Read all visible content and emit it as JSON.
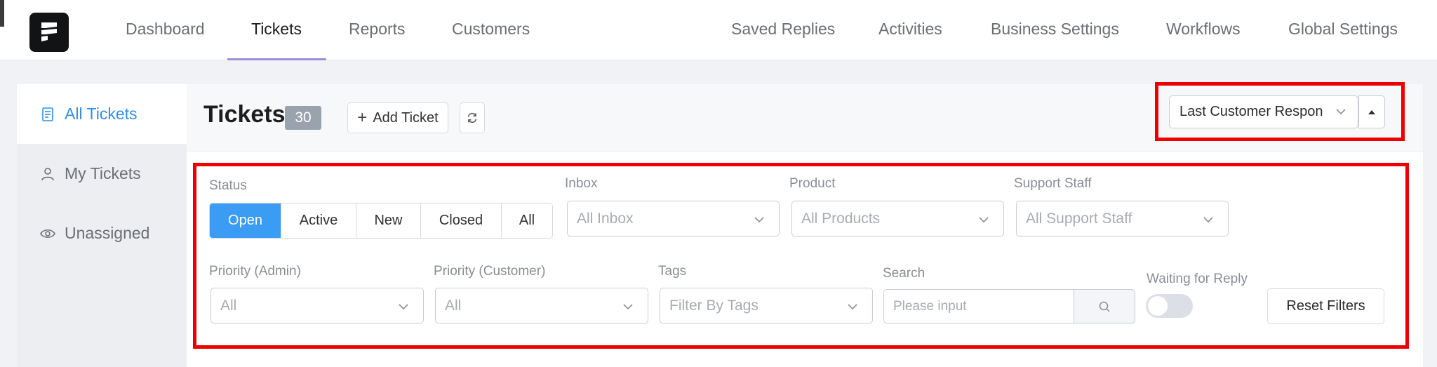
{
  "nav": {
    "left": [
      "Dashboard",
      "Tickets",
      "Reports",
      "Customers"
    ],
    "right": [
      "Saved Replies",
      "Activities",
      "Business Settings",
      "Workflows",
      "Global Settings"
    ],
    "active": "Tickets"
  },
  "sidebar": {
    "items": [
      {
        "label": "All Tickets",
        "icon": "document-icon",
        "active": true
      },
      {
        "label": "My Tickets",
        "icon": "user-icon",
        "active": false
      },
      {
        "label": "Unassigned",
        "icon": "eye-icon",
        "active": false
      }
    ]
  },
  "header": {
    "title": "Tickets",
    "count": "30",
    "add_ticket_label": "Add Ticket",
    "sort_value": "Last Customer Respon",
    "accent_color": "#3b9cf4",
    "highlight_color": "#ee0000"
  },
  "filters": {
    "status_label": "Status",
    "status_options": [
      "Open",
      "Active",
      "New",
      "Closed",
      "All"
    ],
    "status_selected": "Open",
    "inbox": {
      "label": "Inbox",
      "placeholder": "All Inbox"
    },
    "product": {
      "label": "Product",
      "placeholder": "All Products"
    },
    "support_staff": {
      "label": "Support Staff",
      "placeholder": "All Support Staff"
    },
    "priority_admin": {
      "label": "Priority (Admin)",
      "placeholder": "All"
    },
    "priority_customer": {
      "label": "Priority (Customer)",
      "placeholder": "All"
    },
    "tags": {
      "label": "Tags",
      "placeholder": "Filter By Tags"
    },
    "search": {
      "label": "Search",
      "placeholder": "Please input"
    },
    "waiting": {
      "label": "Waiting for Reply",
      "enabled": false
    },
    "reset_label": "Reset Filters"
  }
}
